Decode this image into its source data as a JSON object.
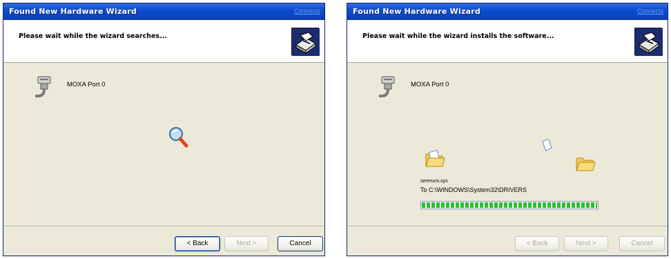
{
  "wizards": [
    {
      "title": "Found New Hardware Wizard",
      "title_link": "Connects",
      "header": "Please wait while the wizard searches...",
      "device_name": "MOXA Port 0",
      "buttons": {
        "back": "< Back",
        "next": "Next >",
        "cancel": "Cancel"
      }
    },
    {
      "title": "Found New Hardware Wizard",
      "title_link": "Connects",
      "header": "Please wait while the wizard installs the software...",
      "device_name": "MOXA Port 0",
      "copy_file": "serenum.sys",
      "copy_dest": "To C:\\WINDOWS\\System32\\DRIVERS",
      "progress": 1.0,
      "buttons": {
        "back": "< Back",
        "next": "Next >",
        "cancel": "Cancel"
      }
    }
  ],
  "colors": {
    "titlebar": "#0a46c4",
    "dialog_bg": "#ece9d8",
    "progress": "#2fbe2f"
  },
  "icons": {
    "header": "hardware-install-icon",
    "device": "serial-port-icon",
    "search": "magnifier-search-icon",
    "folder": "folder-icon",
    "document": "document-icon"
  }
}
